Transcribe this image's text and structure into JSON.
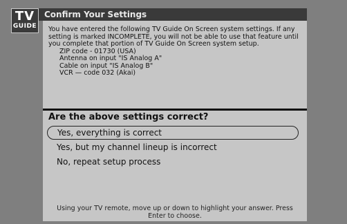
{
  "logo": {
    "line1": "TV",
    "line2": "GUIDE"
  },
  "header": {
    "title": "Confirm Your Settings"
  },
  "info": {
    "text": "You have entered the following TV Guide On Screen system settings. If any setting is marked INCOMPLETE, you will not be able to use that feature until you complete that portion of TV Guide On Screen system setup.",
    "settings": [
      "ZIP code - 01730 (USA)",
      "Antenna on input \"IS Analog A\"",
      "Cable on input \"IS Analog B\"",
      "VCR — code 032 (Akai)"
    ]
  },
  "question": "Are the above settings correct?",
  "options": [
    {
      "label": "Yes, everything is correct",
      "selected": true
    },
    {
      "label": "Yes, but my channel lineup is incorrect",
      "selected": false
    },
    {
      "label": "No, repeat setup process",
      "selected": false
    }
  ],
  "footer": "Using your TV remote, move up or down to highlight your answer.  Press Enter to choose."
}
